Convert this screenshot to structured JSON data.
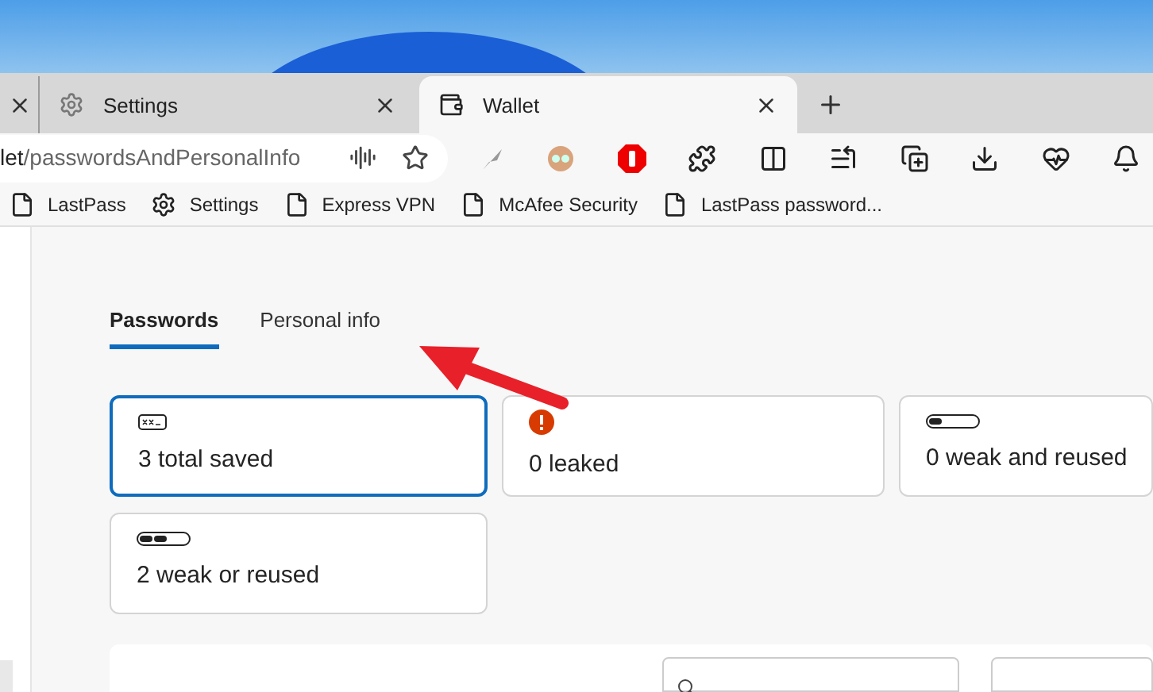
{
  "browser_tabs": [
    {
      "title": "Settings",
      "selected": false
    },
    {
      "title": "Wallet",
      "selected": true
    }
  ],
  "address_bar": {
    "host_part": "let",
    "path_part": "/passwordsAndPersonalInfo"
  },
  "bookmarks": [
    {
      "label": "LastPass",
      "kind": "page"
    },
    {
      "label": "Settings",
      "kind": "gear"
    },
    {
      "label": "Express VPN",
      "kind": "page"
    },
    {
      "label": "McAfee Security",
      "kind": "page"
    },
    {
      "label": "LastPass password...",
      "kind": "page"
    }
  ],
  "wallet_tabs": [
    {
      "label": "Passwords",
      "selected": true
    },
    {
      "label": "Personal info",
      "selected": false
    }
  ],
  "summary_cards": [
    {
      "kind": "total",
      "label": "3 total saved",
      "selected": true
    },
    {
      "kind": "leaked",
      "label": "0 leaked",
      "selected": false
    },
    {
      "kind": "weak",
      "label": "0 weak and reused",
      "selected": false
    },
    {
      "kind": "weak2",
      "label": "2 weak or reused",
      "selected": false
    }
  ]
}
